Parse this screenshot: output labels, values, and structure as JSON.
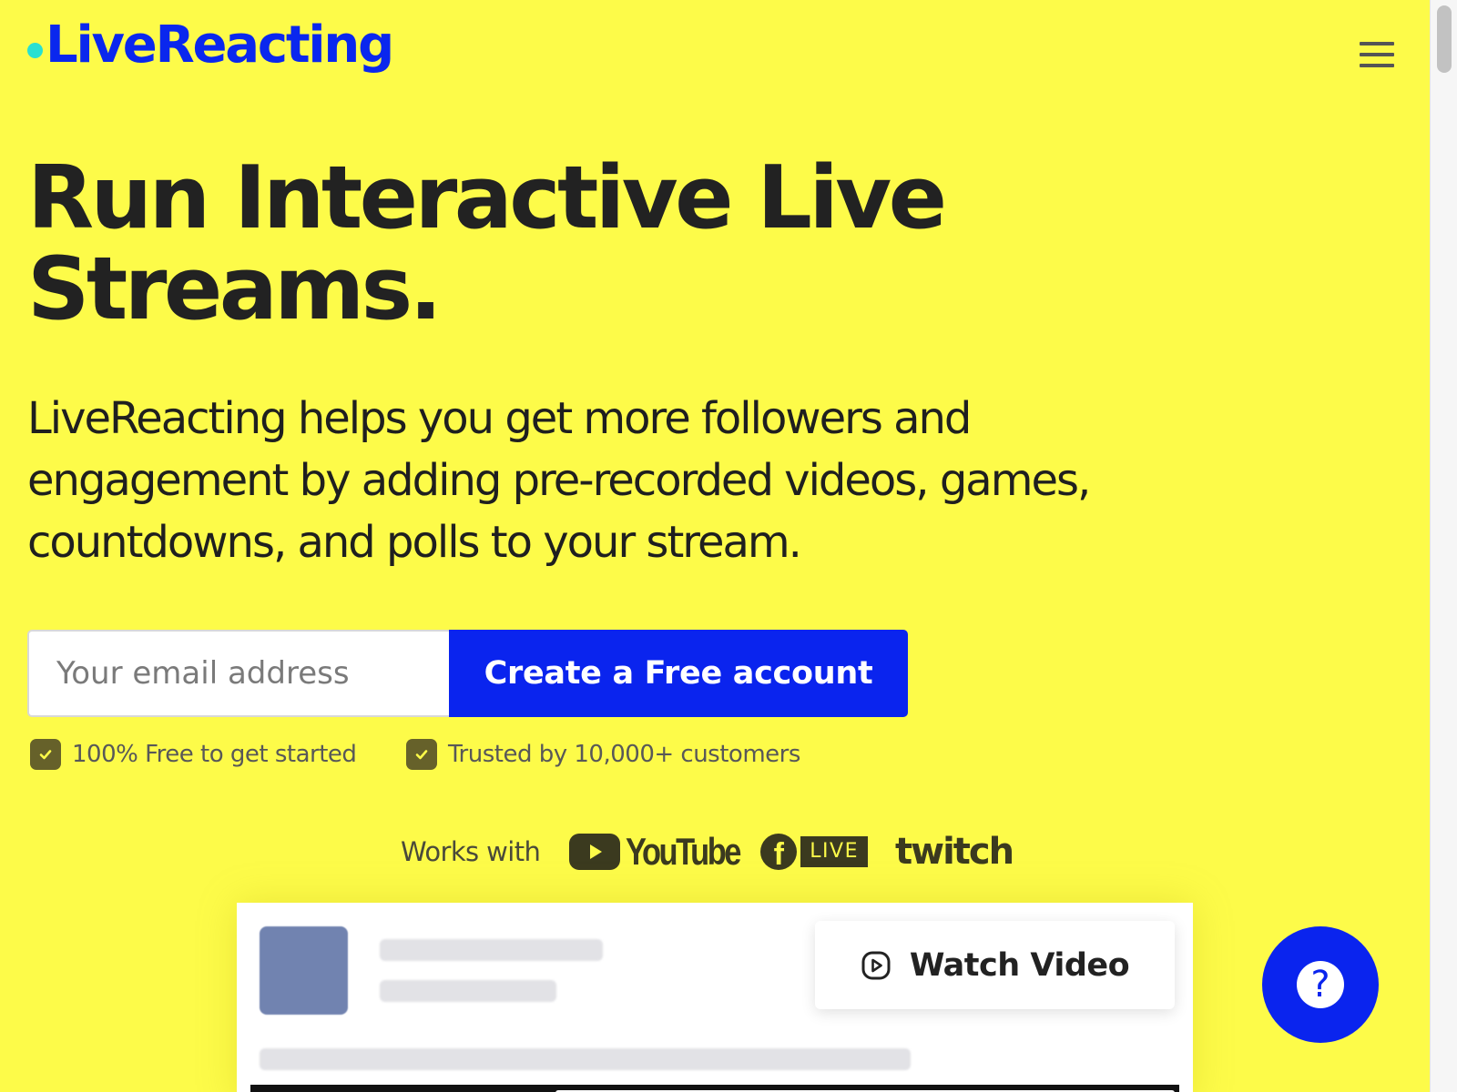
{
  "header": {
    "logo_text": "LiveReacting",
    "menu_icon": "hamburger-menu-icon"
  },
  "hero": {
    "title_line1": "Run Interactive Live",
    "title_line2": "Streams.",
    "subtitle": "LiveReacting helps you get more followers and engagement by adding pre-recorded videos, games, countdowns, and polls to your stream."
  },
  "signup": {
    "email_placeholder": "Your email address",
    "email_value": "",
    "cta_label": "Create a Free account"
  },
  "badges": [
    {
      "icon": "check-icon",
      "text": "100% Free to get started"
    },
    {
      "icon": "check-icon",
      "text": "Trusted by 10,000+ customers"
    }
  ],
  "works_with": {
    "label": "Works with",
    "platforms": [
      {
        "icon": "youtube-logo-icon",
        "name": "YouTube"
      },
      {
        "icon": "facebook-logo-icon",
        "name": "f",
        "badge": "LIVE"
      },
      {
        "icon": "twitch-logo-icon",
        "name": "twitch"
      }
    ]
  },
  "preview": {
    "watch_label": "Watch Video",
    "watch_icon": "play-circle-icon"
  },
  "help": {
    "icon": "question-mark-icon",
    "glyph": "?"
  },
  "colors": {
    "background": "#fdfb49",
    "brand_blue": "#0a24ee",
    "logo_dot": "#29e0d2",
    "text_dark": "#222222"
  }
}
